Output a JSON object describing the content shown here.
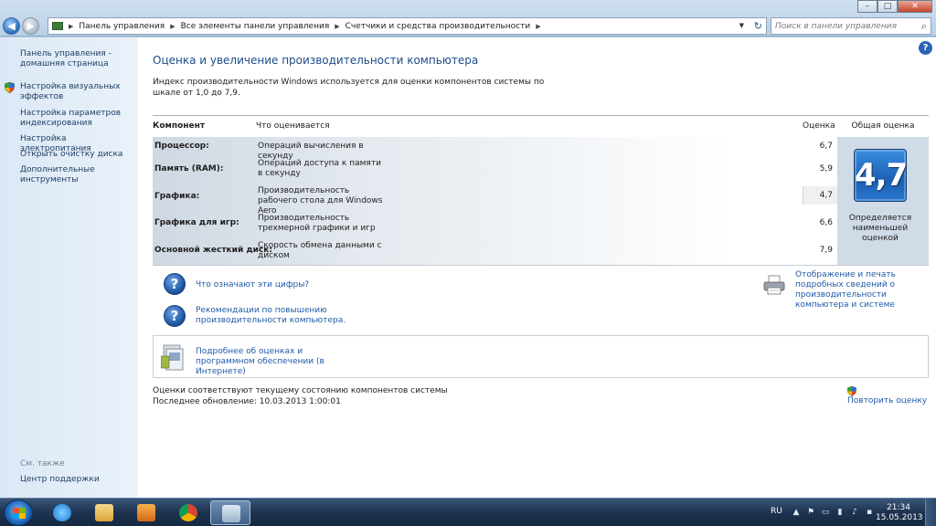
{
  "window": {
    "controls": {
      "minimize": "–",
      "maximize": "□",
      "close": "✕"
    }
  },
  "nav": {
    "back_icon": "arrow-left-icon",
    "forward_icon": "arrow-right-icon",
    "breadcrumbs": [
      "Панель управления",
      "Все элементы панели управления",
      "Счетчики и средства производительности"
    ],
    "search_placeholder": "Поиск в панели управления"
  },
  "sidebar": {
    "home_link": "Панель управления - домашняя страница",
    "items": [
      {
        "label": "Настройка визуальных эффектов",
        "shield": true
      },
      {
        "label": "Настройка параметров индексирования",
        "shield": false
      },
      {
        "label": "Настройка электропитания",
        "shield": false
      },
      {
        "label": "Открыть очистку диска",
        "shield": false
      },
      {
        "label": "Дополнительные инструменты",
        "shield": false
      }
    ],
    "see_also_title": "См. также",
    "see_also_items": [
      "Центр поддержки"
    ]
  },
  "main": {
    "title": "Оценка и увеличение производительности компьютера",
    "description": "Индекс производительности Windows используется для оценки компонентов системы по шкале от 1,0 до 7,9.",
    "table": {
      "headers": {
        "component": "Компонент",
        "rated": "Что оценивается",
        "score": "Оценка",
        "base_score": "Общая оценка"
      },
      "rows": [
        {
          "component": "Процессор:",
          "rated": "Операций вычисления в секунду",
          "score": "6,7"
        },
        {
          "component": "Память (RAM):",
          "rated": "Операций доступа к памяти в секунду",
          "score": "5,9"
        },
        {
          "component": "Графика:",
          "rated": "Производительность рабочего стола для Windows Aero",
          "score": "4,7"
        },
        {
          "component": "Графика для игр:",
          "rated": "Производительность трехмерной графики и игр",
          "score": "6,6"
        },
        {
          "component": "Основной жесткий диск:",
          "rated": "Скорость обмена данными с диском",
          "score": "7,9"
        }
      ],
      "base_score_value": "4,7",
      "base_score_note": "Определяется наименьшей оценкой"
    },
    "links": {
      "what_numbers": "Что означают эти цифры?",
      "tips": "Рекомендации по повышению производительности компьютера.",
      "view_print": "Отображение и печать подробных сведений о производительности компьютера и системе",
      "learn_more": "Подробнее об оценках и программном обеспечении (в Интернете)"
    },
    "status": {
      "current": "Оценки соответствуют текущему состоянию компонентов системы",
      "last_update": "Последнее обновление: 10.03.2013 1:00:01",
      "rerun": "Повторить оценку"
    }
  },
  "taskbar": {
    "apps": [
      "internet-explorer-icon",
      "explorer-folder-icon",
      "media-player-icon",
      "chrome-icon",
      "control-panel-icon"
    ],
    "language": "RU",
    "time": "21:34",
    "date": "15.05.2013"
  }
}
